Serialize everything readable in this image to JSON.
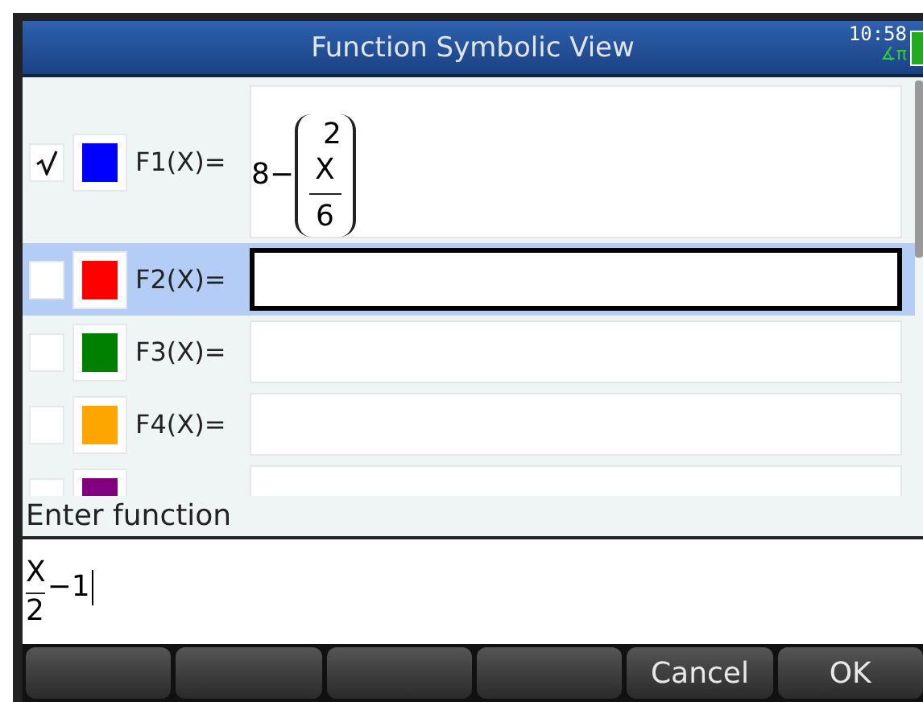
{
  "header": {
    "title": "Function Symbolic View",
    "time": "10:58",
    "mode_indicator": "∡π"
  },
  "functions": [
    {
      "label": "F1(X)=",
      "checked": true,
      "color": "#0000ff",
      "selected": false,
      "expression": {
        "lead": "8−",
        "exponent": "2",
        "numerator": "X",
        "denominator": "6"
      }
    },
    {
      "label": "F2(X)=",
      "checked": false,
      "color": "#ff0000",
      "selected": true
    },
    {
      "label": "F3(X)=",
      "checked": false,
      "color": "#008000",
      "selected": false
    },
    {
      "label": "F4(X)=",
      "checked": false,
      "color": "#ffa500",
      "selected": false
    },
    {
      "checked": false,
      "color": "#800080",
      "selected": false
    }
  ],
  "prompt": "Enter function",
  "entry": {
    "numerator": "X",
    "denominator": "2",
    "rest": "−1"
  },
  "softkeys": [
    {
      "kind": "empty"
    },
    {
      "kind": "empty"
    },
    {
      "kind": "empty"
    },
    {
      "kind": "empty"
    },
    {
      "kind": "label",
      "label": "Cancel"
    },
    {
      "kind": "label",
      "label": "OK"
    }
  ]
}
